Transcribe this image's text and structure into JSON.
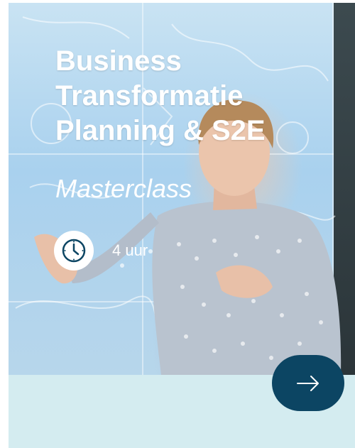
{
  "card": {
    "title_lines": [
      "Business",
      "Transformatie",
      "Planning & S2E"
    ],
    "subtitle": "Masterclass",
    "duration": "4 uur",
    "icons": {
      "duration": "clock-icon",
      "next": "arrow-right-icon"
    }
  },
  "colors": {
    "button": "#0c4563",
    "footer": "#d4ecf0",
    "text": "#ffffff"
  }
}
